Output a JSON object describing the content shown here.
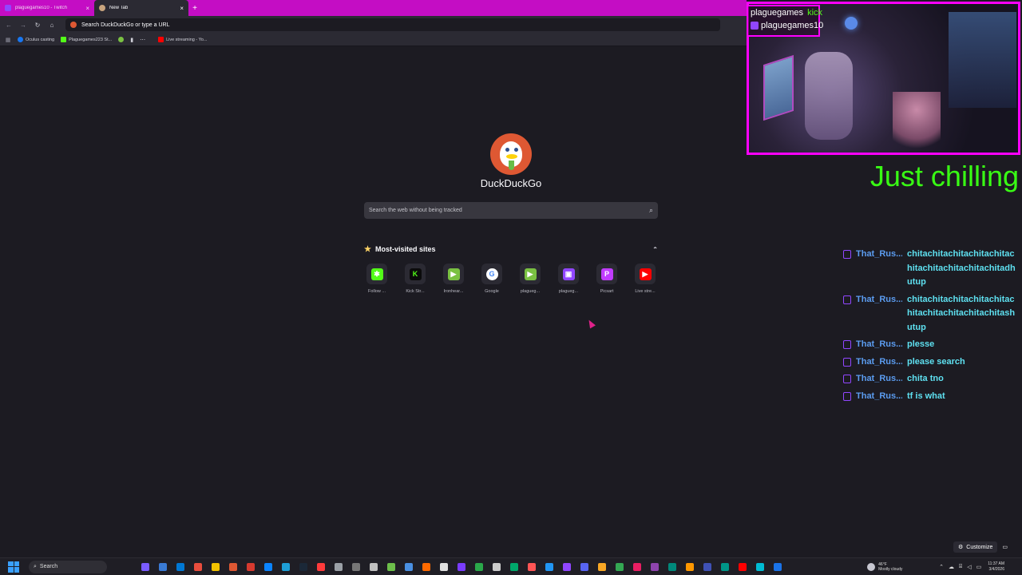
{
  "browser": {
    "tabs": [
      {
        "title": "plaguegames10 - Twitch",
        "favicon_color": "#9146ff",
        "active": false
      },
      {
        "title": "New Tab",
        "favicon_color": "#c8a47e",
        "active": true
      }
    ],
    "new_tab_symbol": "+",
    "close_symbol": "×",
    "url_placeholder": "Search DuckDuckGo or type a URL",
    "bookmarks": [
      {
        "label": "Oculus casting",
        "color": "#1877f2"
      },
      {
        "label": "Plaguegames223 St...",
        "color": "#53fc18"
      },
      {
        "label": "",
        "color": "#7ac142"
      },
      {
        "label": "Live streaming - Yo...",
        "color": "#ff0000"
      }
    ]
  },
  "newtab": {
    "brand": "DuckDuckGo",
    "search_placeholder": "Search the web without being tracked",
    "most_visited_title": "Most-visited sites",
    "sites": [
      {
        "label": "Follow ...",
        "icon_color": "#53fc18",
        "glyph": "✱",
        "icon_name": "follow-icon"
      },
      {
        "label": "Kick Str...",
        "icon_color": "#0b0b0b",
        "glyph": "K",
        "icon_name": "kick-icon"
      },
      {
        "label": "Ironhear...",
        "icon_color": "#7ac142",
        "glyph": "▶",
        "icon_name": "play-icon"
      },
      {
        "label": "Google",
        "icon_color": "#ffffff",
        "glyph": "G",
        "icon_name": "google-icon"
      },
      {
        "label": "plagueg...",
        "icon_color": "#7ac142",
        "glyph": "▶",
        "icon_name": "play-icon"
      },
      {
        "label": "plagueg...",
        "icon_color": "#9146ff",
        "glyph": "▣",
        "icon_name": "twitch-icon"
      },
      {
        "label": "Picsart",
        "icon_color": "#c13cff",
        "glyph": "P",
        "icon_name": "picsart-icon"
      },
      {
        "label": "Live stre...",
        "icon_color": "#ff0000",
        "glyph": "▶",
        "icon_name": "youtube-icon"
      }
    ]
  },
  "overlay": {
    "streamer": "plaguegames",
    "platform_label": "kick",
    "streamer_alt": "plaguegames10",
    "status": "Just chilling",
    "chat": [
      {
        "user": "That_Rus...",
        "text": "chitachitachitachitachitachitachitachitachitachitadhutup"
      },
      {
        "user": "That_Rus...",
        "text": "chitachitachitachitachitachitachitachitachitachitashutup"
      },
      {
        "user": "That_Rus...",
        "text": "plesse"
      },
      {
        "user": "That_Rus...",
        "text": "please search"
      },
      {
        "user": "That_Rus...",
        "text": "chita tno"
      },
      {
        "user": "That_Rus...",
        "text": "tf is what"
      }
    ]
  },
  "taskbar": {
    "search_label": "Search",
    "customize_label": "Customize",
    "weather_temp": "46°F",
    "weather_desc": "Mostly cloudy",
    "time": "11:37 AM",
    "date": "3/4/2026",
    "app_colors": [
      "#7a5cff",
      "#3a7bd5",
      "#0078d4",
      "#e84d3d",
      "#f2c200",
      "#de5833",
      "#d73a2f",
      "#0a84ff",
      "#1e9fd6",
      "#1b2838",
      "#ff3b3b",
      "#9aa0a6",
      "#777777",
      "#c0c0c0",
      "#6dbf4b",
      "#4a90e2",
      "#ff6a00",
      "#e0e0e0",
      "#7a3cff",
      "#2aa84a",
      "#cccccc",
      "#00a86b",
      "#ff5555",
      "#2196f3",
      "#9146ff",
      "#5865f2",
      "#f9a825",
      "#34a853",
      "#e91e63",
      "#8e44ad",
      "#00897b",
      "#ff9800",
      "#3f51b5",
      "#009688",
      "#ff0000",
      "#00bcd4",
      "#1a73e8"
    ]
  }
}
